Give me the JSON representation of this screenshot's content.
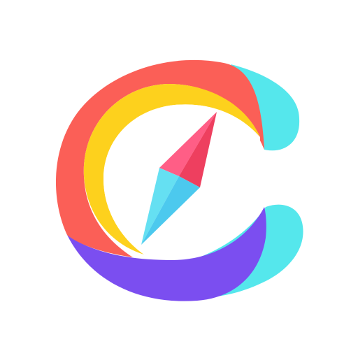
{
  "icon": {
    "name": "compass-logo-icon",
    "colors": {
      "background": "#ffffff",
      "red": "#FB5F57",
      "yellow": "#FDD11D",
      "purple": "#7B4EF0",
      "cyan": "#55E7EC",
      "needle_red_light": "#FF5E86",
      "needle_red_dark": "#EE3F5F",
      "needle_blue_light": "#65E0F2",
      "needle_blue_dark": "#4CC9EE"
    }
  }
}
